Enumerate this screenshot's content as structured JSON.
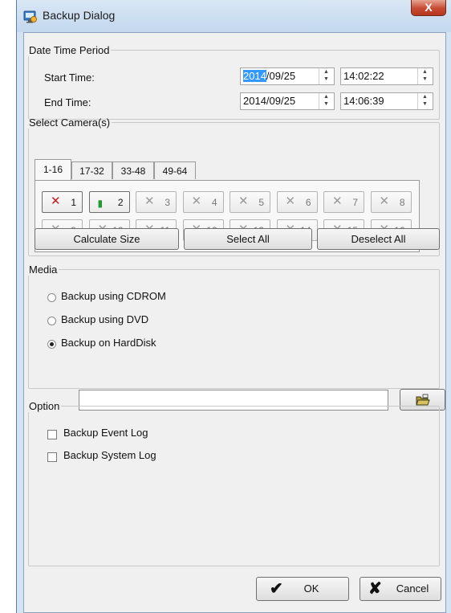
{
  "window": {
    "title": "Backup Dialog",
    "close_glyph": "X",
    "icon": "backup-app-icon"
  },
  "date_time_period": {
    "legend": "Date Time Period",
    "start": {
      "label": "Start Time:",
      "date_year_selected": "2014",
      "date_rest": "/09/25",
      "time": "14:02:22"
    },
    "end": {
      "label": "End Time:",
      "date": "2014/09/25",
      "time": "14:06:39"
    }
  },
  "select_cameras": {
    "legend": "Select Camera(s)",
    "tabs": [
      "1-16",
      "17-32",
      "33-48",
      "49-64"
    ],
    "active_tab": "1-16",
    "cameras": [
      {
        "num": "1",
        "state": "selected-red"
      },
      {
        "num": "2",
        "state": "selected-green"
      },
      {
        "num": "3",
        "state": "disabled"
      },
      {
        "num": "4",
        "state": "disabled"
      },
      {
        "num": "5",
        "state": "disabled"
      },
      {
        "num": "6",
        "state": "disabled"
      },
      {
        "num": "7",
        "state": "disabled"
      },
      {
        "num": "8",
        "state": "disabled"
      },
      {
        "num": "9",
        "state": "disabled"
      },
      {
        "num": "10",
        "state": "disabled"
      },
      {
        "num": "11",
        "state": "disabled"
      },
      {
        "num": "12",
        "state": "disabled"
      },
      {
        "num": "13",
        "state": "disabled"
      },
      {
        "num": "14",
        "state": "disabled"
      },
      {
        "num": "15",
        "state": "disabled"
      },
      {
        "num": "16",
        "state": "disabled"
      }
    ],
    "buttons": {
      "calculate": "Calculate Size",
      "select_all": "Select All",
      "deselect_all": "Deselect All"
    }
  },
  "media": {
    "legend": "Media",
    "options": [
      {
        "label": "Backup using CDROM",
        "checked": false
      },
      {
        "label": "Backup using DVD",
        "checked": false
      },
      {
        "label": "Backup on HardDisk",
        "checked": true
      }
    ],
    "path_value": "",
    "browse_icon": "folder-open-icon"
  },
  "option": {
    "legend": "Option",
    "checks": [
      {
        "label": "Backup Event Log",
        "checked": false
      },
      {
        "label": "Backup System Log",
        "checked": false
      }
    ]
  },
  "footer": {
    "ok_label": "OK",
    "cancel_label": "Cancel",
    "ok_icon": "checkmark-icon",
    "cancel_icon": "x-icon"
  },
  "colors": {
    "selection": "#3399ff",
    "titlebar": "#c3d7ee",
    "close_red": "#c74a32",
    "camera_red": "#c61a1a",
    "camera_green": "#1e9a2e"
  }
}
